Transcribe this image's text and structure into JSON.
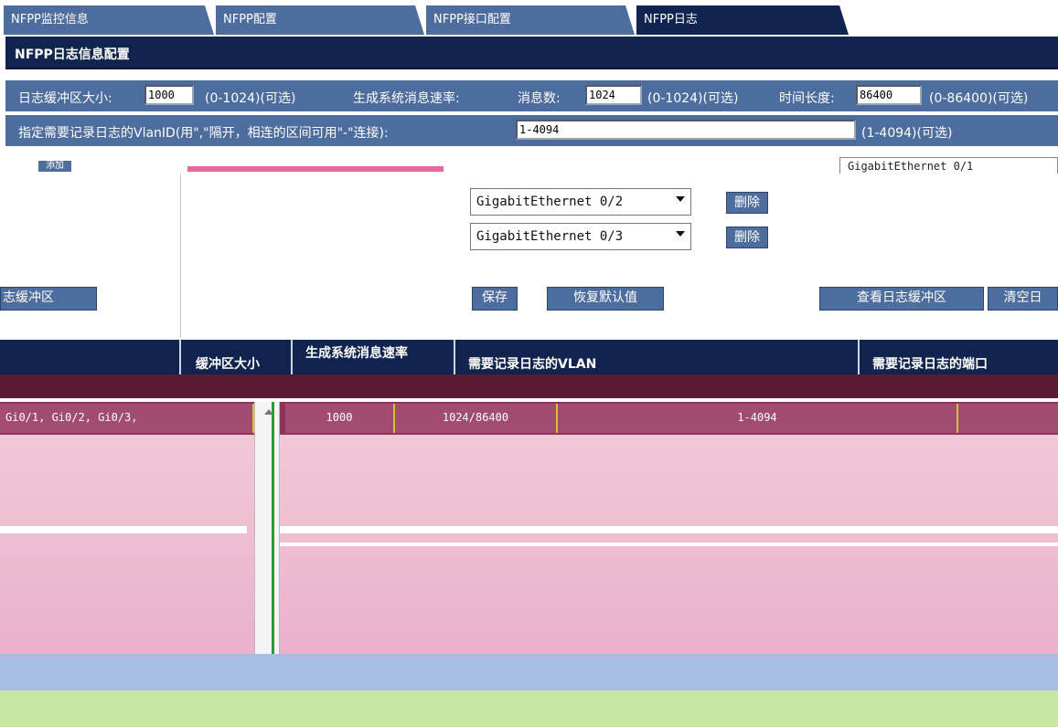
{
  "tabs": [
    {
      "label": "NFPP监控信息"
    },
    {
      "label": "NFPP配置"
    },
    {
      "label": "NFPP接口配置"
    },
    {
      "label": "NFPP日志"
    }
  ],
  "section_title": "NFPP日志信息配置",
  "config": {
    "buffer_size_label": "日志缓冲区大小:",
    "buffer_size_value": "1000",
    "buffer_size_range": "(0-1024)(可选)",
    "rate_label": "生成系统消息速率:",
    "message_count_label": "消息数:",
    "message_count_value": "1024",
    "message_count_range": "(0-1024)(可选)",
    "duration_label": "时间长度:",
    "duration_value": "86400",
    "duration_range": "(0-86400)(可选)",
    "vlan_label": "指定需要记录日志的VlanID(用\",\"隔开，相连的区间可用\"-\"连接):",
    "vlan_value": "1-4094",
    "vlan_range": "(1-4094)(可选)"
  },
  "ports": {
    "add_label": "添加",
    "top_port_partial": "GigabitEthernet 0/1",
    "items": [
      {
        "value": "GigabitEthernet 0/2",
        "delete_label": "删除"
      },
      {
        "value": "GigabitEthernet 0/3",
        "delete_label": "删除"
      }
    ]
  },
  "actions": {
    "left_partial": "志缓冲区",
    "save": "保存",
    "restore_default": "恢复默认值",
    "view_buffer": "查看日志缓冲区",
    "clear_partial": "清空日"
  },
  "table": {
    "headers": [
      "缓冲区大小",
      "生成系统消息速率",
      "需要记录日志的VLAN",
      "需要记录日志的端口"
    ],
    "row": {
      "ports_partial": "Gi0/1, Gi0/2, Gi0/3,",
      "buffer": "1000",
      "rate": "1024/86400",
      "vlan": "1-4094"
    }
  },
  "colors": {
    "tab": "#4d6d9e",
    "tab_active": "#11244f",
    "header": "#11244f",
    "row": "#a24c72"
  }
}
